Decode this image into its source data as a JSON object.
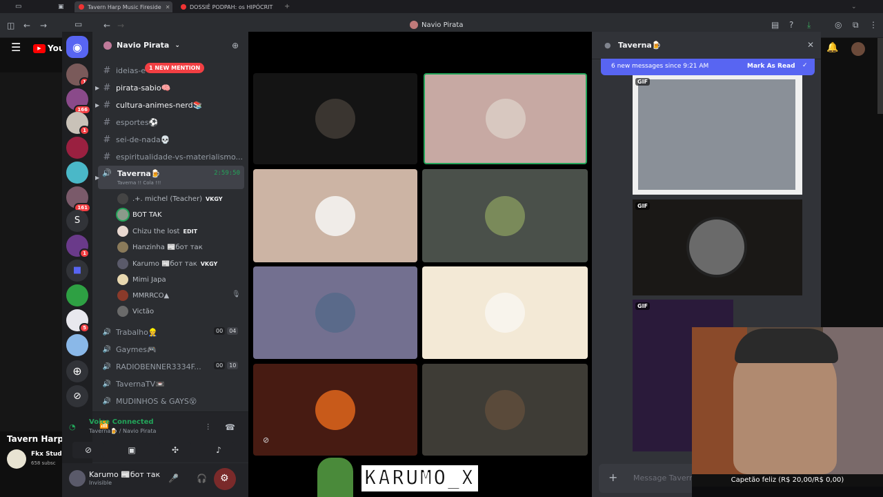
{
  "browser": {
    "tabs": [
      {
        "title": "Tavern Harp Music Fireside"
      },
      {
        "title": "DOSSIÊ PODPAH: os HIPÓCRIT"
      }
    ],
    "window_title": "Navio Pirata"
  },
  "youtube": {
    "logo_text": "You",
    "video_title": "Tavern Harp",
    "channel_name": "Fkx Stud",
    "subscribers": "658 subsc"
  },
  "servers": [
    {
      "badge": "1"
    },
    {
      "badge": "166"
    },
    {
      "badge": "1"
    },
    {
      "badge": ""
    },
    {
      "badge": ""
    },
    {
      "badge": "161"
    },
    {
      "letter": "S"
    },
    {
      "badge": "1"
    },
    {
      "badge": ""
    },
    {
      "badge": ""
    },
    {
      "badge": "5"
    },
    {
      "badge": ""
    }
  ],
  "sidebar": {
    "server_name": "Navio Pirata",
    "mention_pill": "1 NEW MENTION",
    "channels": [
      {
        "name": "ideias-e"
      },
      {
        "name": "pirata-sabio🧠"
      },
      {
        "name": "cultura-animes-nerd📚"
      },
      {
        "name": "esportes⚽"
      },
      {
        "name": "sei-de-nada💀"
      },
      {
        "name": "espiritualidade-vs-materialismo..."
      }
    ],
    "voice_channel": {
      "name": "Taverna🍺",
      "timer": "2:59:50",
      "status": "Taverna !! Cola !!!"
    },
    "voice_users": [
      {
        "name": ".+. michel (Teacher)",
        "tag": "VKGY"
      },
      {
        "name": "BOT TAK",
        "tag": ""
      },
      {
        "name": "Chizu the lost",
        "tag": "EDIT"
      },
      {
        "name": "Hanzinha 📰бот так",
        "tag": ""
      },
      {
        "name": "Karumo 📰бот так",
        "tag": "VKGY"
      },
      {
        "name": "Mimi Japa",
        "tag": ""
      },
      {
        "name": "MMRRCO▲",
        "tag": ""
      },
      {
        "name": "Victão",
        "tag": ""
      }
    ],
    "other_voice": [
      {
        "name": "Trabalho👷",
        "a": "00",
        "b": "04"
      },
      {
        "name": "Gaymes🎮",
        "a": "",
        "b": ""
      },
      {
        "name": "RADIOBENNER3334F...",
        "a": "00",
        "b": "10"
      },
      {
        "name": "TavernaTV📼",
        "a": "",
        "b": ""
      },
      {
        "name": "MUDINHOS & GAYS😵",
        "a": "",
        "b": ""
      }
    ],
    "voice_panel": {
      "status": "Voice Connected",
      "location": "Taverna🍺 / Navio Pirata"
    },
    "user": {
      "name": "Karumo 📰бот так",
      "status": "Invisible"
    }
  },
  "chat": {
    "channel": "Taverna🍺",
    "new_messages": "6 new messages since 9:21 AM",
    "mark_read": "Mark As Read",
    "gif_label": "GIF",
    "input_placeholder": "Message Taverna"
  },
  "overlay": {
    "name_banner": "KARUMO_X",
    "donation": "Capetão feliz (R$ 20,00/R$ 0,00)"
  }
}
